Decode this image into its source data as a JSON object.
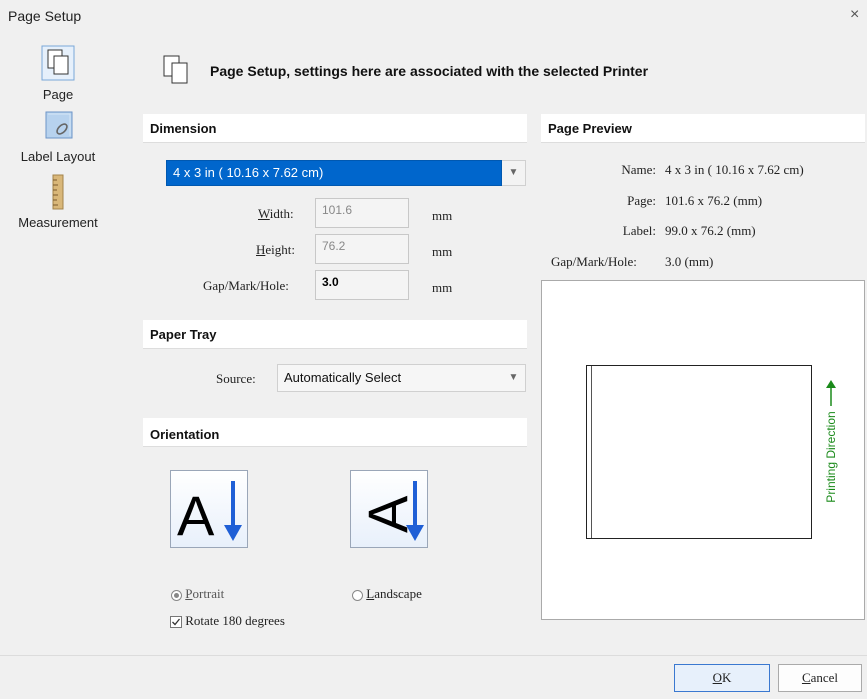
{
  "window": {
    "title": "Page Setup",
    "close_glyph": "×"
  },
  "nav": [
    {
      "label": "Page",
      "icon": "page-icon"
    },
    {
      "label": "Label Layout",
      "icon": "label-layout-icon"
    },
    {
      "label": "Measurement",
      "icon": "ruler-icon"
    }
  ],
  "banner": {
    "text": "Page Setup, settings here are associated with the selected Printer"
  },
  "dimension": {
    "header": "Dimension",
    "size_value": "4 x 3 in ( 10.16 x 7.62 cm)",
    "width_label_u": "W",
    "width_label_rest": "idth:",
    "width_value": "101.6",
    "height_label_u": "H",
    "height_label_rest": "eight:",
    "height_value": "76.2",
    "gap_label": "Gap/Mark/Hole:",
    "gap_value": "3.0",
    "unit": "mm"
  },
  "paper_tray": {
    "header": "Paper Tray",
    "source_label": "Source:",
    "source_value": "Automatically Select"
  },
  "orientation": {
    "header": "Orientation",
    "portrait_u": "P",
    "portrait_rest": "ortrait",
    "landscape_u": "L",
    "landscape_rest": "andscape",
    "rotate_label": "Rotate 180 degrees",
    "selected": "portrait",
    "rotate_checked": true
  },
  "preview": {
    "header": "Page Preview",
    "name_label": "Name:",
    "name_value": "4 x 3 in ( 10.16 x 7.62 cm)",
    "page_label": "Page:",
    "page_value": "101.6  x  76.2  (mm)",
    "label_label": "Label:",
    "label_value": "99.0  x  76.2  (mm)",
    "gap_label": "Gap/Mark/Hole:",
    "gap_value": "3.0  (mm)",
    "direction_text": "Printing Direction",
    "direction_color": "#1a8a1a"
  },
  "buttons": {
    "ok_u": "O",
    "ok_rest": "K",
    "cancel_u": "C",
    "cancel_rest": "ancel"
  },
  "colors": {
    "accent": "#0066cc",
    "arrow_blue": "#1f5fd6"
  }
}
